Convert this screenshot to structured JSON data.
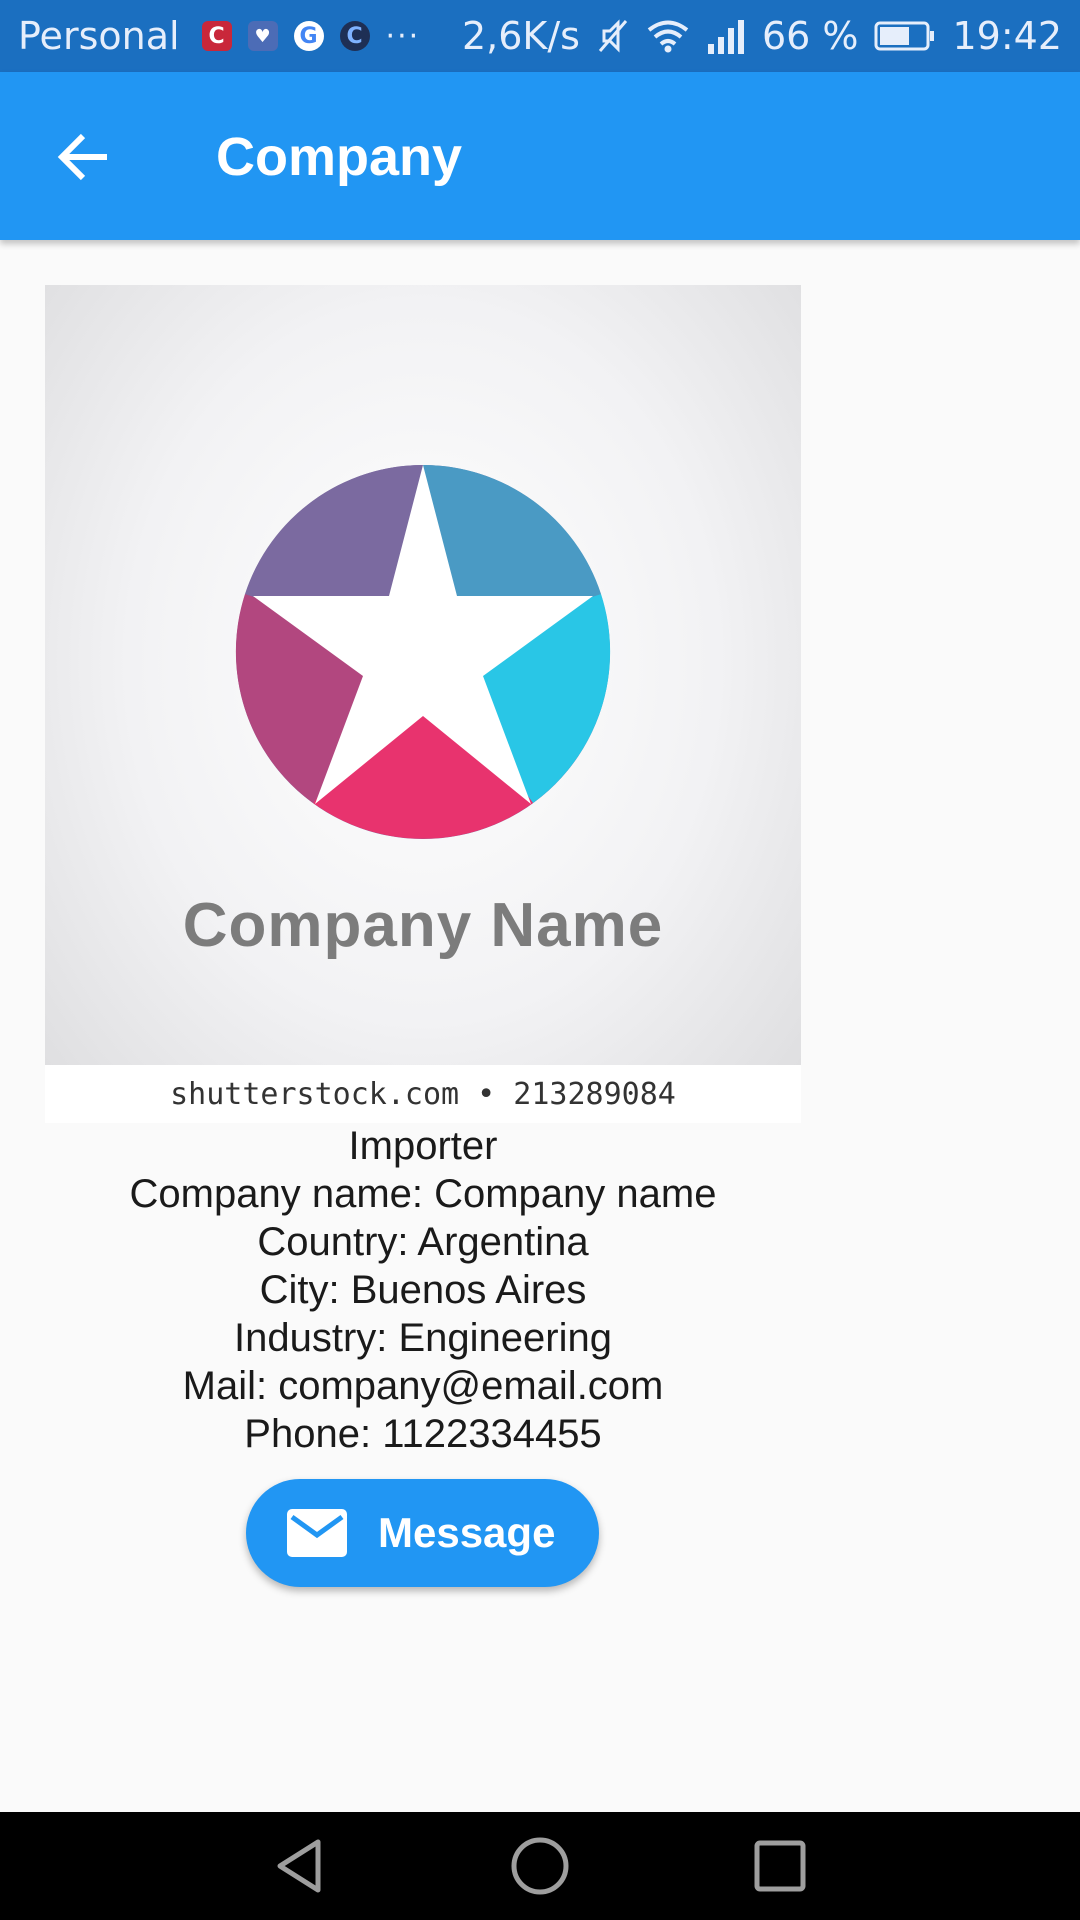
{
  "status_bar": {
    "carrier": "Personal",
    "apps": [
      {
        "icon": "c-app-icon",
        "glyph": "C"
      },
      {
        "icon": "health-app-icon",
        "glyph": "♥"
      },
      {
        "icon": "google-icon",
        "glyph": "G"
      },
      {
        "icon": "c-circle-app-icon",
        "glyph": "C"
      }
    ],
    "overflow": "···",
    "network_speed": "2,6K/s",
    "battery_percent": "66 %",
    "battery_level": 0.66,
    "time": "19:42"
  },
  "app_bar": {
    "title": "Company"
  },
  "company_image": {
    "logo_text": "Company Name",
    "watermark": "shutterstock.com • 213289084",
    "star_colors": [
      "#7b6aa0",
      "#4a9ac4",
      "#29c6e6",
      "#e8336e",
      "#b2477f"
    ]
  },
  "details": {
    "type": "Importer",
    "company_name": "Company name: Company name",
    "country": "Country: Argentina",
    "city": "City: Buenos Aires",
    "industry": "Industry: Engineering",
    "mail": "Mail: company@email.com",
    "phone": "Phone: 1122334455"
  },
  "message_button": {
    "label": "Message",
    "icon": "mail-icon"
  },
  "colors": {
    "primary": "#2196f3",
    "status_bar": "#1b6fc0",
    "background": "#fafafa",
    "nav_bar": "#000000"
  }
}
